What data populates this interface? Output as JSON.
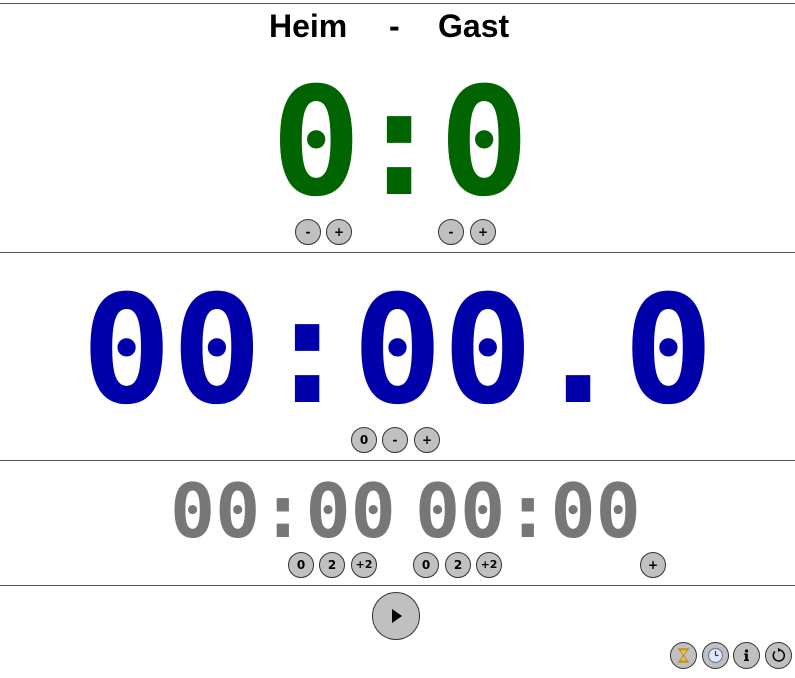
{
  "score": {
    "home_name": "Heim",
    "separator": "-",
    "guest_name": "Gast",
    "home_score": "0",
    "colon": ":",
    "guest_score": "0",
    "home_minus": "-",
    "home_plus": "+",
    "guest_minus": "-",
    "guest_plus": "+",
    "color": "#006400"
  },
  "game_clock": {
    "time": "00:00.0",
    "reset_label": "0",
    "minus_label": "-",
    "plus_label": "+",
    "color": "#0000aa"
  },
  "penalties": {
    "home_time": "00:00",
    "guest_time": "00:00",
    "home_reset": "0",
    "home_two": "2",
    "home_plus_two": "+2",
    "guest_reset": "0",
    "guest_two": "2",
    "guest_plus_two": "+2",
    "add_label": "+",
    "color": "#777777"
  },
  "controls": {
    "play_icon": "play-icon",
    "icons": [
      "hourglass-icon",
      "clock-icon",
      "info-icon",
      "reset-icon"
    ]
  }
}
